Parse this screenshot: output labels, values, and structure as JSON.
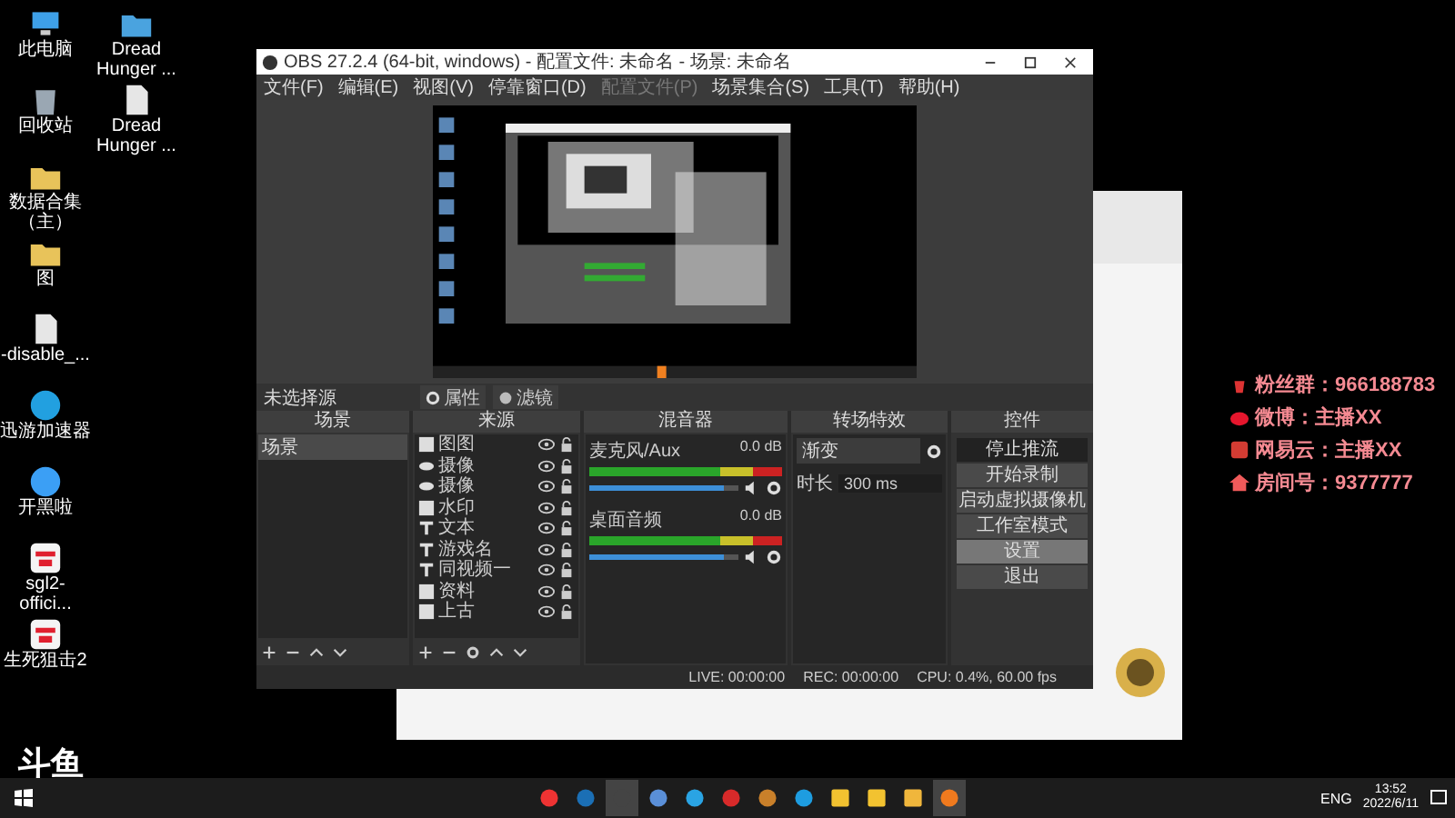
{
  "desktop": {
    "columns": [
      [
        {
          "label": "此电脑",
          "kind": "pc"
        },
        {
          "label": "回收站",
          "kind": "bin"
        },
        {
          "label": "数据合集（主）",
          "kind": "folder"
        },
        {
          "label": "图",
          "kind": "folder"
        },
        {
          "label": "-disable_...",
          "kind": "doc"
        },
        {
          "label": "迅游加速器",
          "kind": "swirl"
        },
        {
          "label": "开黑啦",
          "kind": "chat"
        },
        {
          "label": "sgl2-offici...",
          "kind": "game"
        },
        {
          "label": "生死狙击2",
          "kind": "game"
        }
      ],
      [
        {
          "label": "Dread Hunger ...",
          "kind": "zip"
        },
        {
          "label": "Dread Hunger ...",
          "kind": "doc"
        }
      ]
    ]
  },
  "logo": "斗鱼",
  "overlay_info": [
    {
      "label": "粉丝群：966188783",
      "kind": "group"
    },
    {
      "label": "微博：主播XX",
      "kind": "weibo"
    },
    {
      "label": "网易云：主播XX",
      "kind": "music"
    },
    {
      "label": "房间号：9377777",
      "kind": "home"
    }
  ],
  "obs": {
    "title": "OBS 27.2.4 (64-bit, windows) - 配置文件: 未命名 - 场景: 未命名",
    "menu": [
      {
        "label": "文件(F)",
        "disabled": false
      },
      {
        "label": "编辑(E)",
        "disabled": false
      },
      {
        "label": "视图(V)",
        "disabled": false
      },
      {
        "label": "停靠窗口(D)",
        "disabled": false
      },
      {
        "label": "配置文件(P)",
        "disabled": true
      },
      {
        "label": "场景集合(S)",
        "disabled": false
      },
      {
        "label": "工具(T)",
        "disabled": false
      },
      {
        "label": "帮助(H)",
        "disabled": false
      }
    ],
    "source_toolbar": {
      "label": "未选择源",
      "buttons": [
        {
          "label": "属性",
          "kind": "gear"
        },
        {
          "label": "滤镜",
          "kind": "filter"
        }
      ]
    },
    "scenes": {
      "title": "场景",
      "items": [
        {
          "label": "场景",
          "selected": true
        }
      ]
    },
    "sources": {
      "title": "来源",
      "items": [
        {
          "label": "图图",
          "kind": "image"
        },
        {
          "label": "摄像",
          "kind": "camera"
        },
        {
          "label": "摄像",
          "kind": "camera"
        },
        {
          "label": "水印",
          "kind": "image"
        },
        {
          "label": "文本",
          "kind": "text"
        },
        {
          "label": "游戏名",
          "kind": "text"
        },
        {
          "label": "同视频一",
          "kind": "text"
        },
        {
          "label": "资料",
          "kind": "image"
        },
        {
          "label": "上古",
          "kind": "image"
        }
      ]
    },
    "mixer": {
      "title": "混音器",
      "channels": [
        {
          "name": "麦克风/Aux",
          "reading": "0.0 dB",
          "level": 0.9
        },
        {
          "name": "桌面音频",
          "reading": "0.0 dB",
          "level": 0.9
        }
      ]
    },
    "transitions": {
      "title": "转场特效",
      "type": "渐变",
      "duration_label": "时长",
      "duration": "300 ms"
    },
    "controls": {
      "title": "控件",
      "buttons": [
        {
          "label": "停止推流",
          "kind": "active"
        },
        {
          "label": "开始录制",
          "kind": "normal"
        },
        {
          "label": "启动虚拟摄像机",
          "kind": "normal"
        },
        {
          "label": "工作室模式",
          "kind": "normal"
        },
        {
          "label": "设置",
          "kind": "hover"
        },
        {
          "label": "退出",
          "kind": "normal"
        }
      ]
    },
    "status": {
      "live": "LIVE: 00:00:00",
      "rec": "REC: 00:00:00",
      "cpu": "CPU: 0.4%, 60.00 fps"
    }
  },
  "taskbar": {
    "apps": [
      {
        "kind": "penguin",
        "selected": false
      },
      {
        "kind": "steam",
        "selected": false
      },
      {
        "kind": "obs",
        "selected": true
      },
      {
        "kind": "globe",
        "selected": false
      },
      {
        "kind": "chat",
        "selected": false
      },
      {
        "kind": "music",
        "selected": false
      },
      {
        "kind": "g",
        "selected": false
      },
      {
        "kind": "drop",
        "selected": false
      },
      {
        "kind": "face",
        "selected": false
      },
      {
        "kind": "face",
        "selected": false
      },
      {
        "kind": "folder",
        "selected": false
      },
      {
        "kind": "fish",
        "selected": true
      }
    ],
    "language": "ENG",
    "time": "13:52",
    "date": "2022/6/11"
  }
}
